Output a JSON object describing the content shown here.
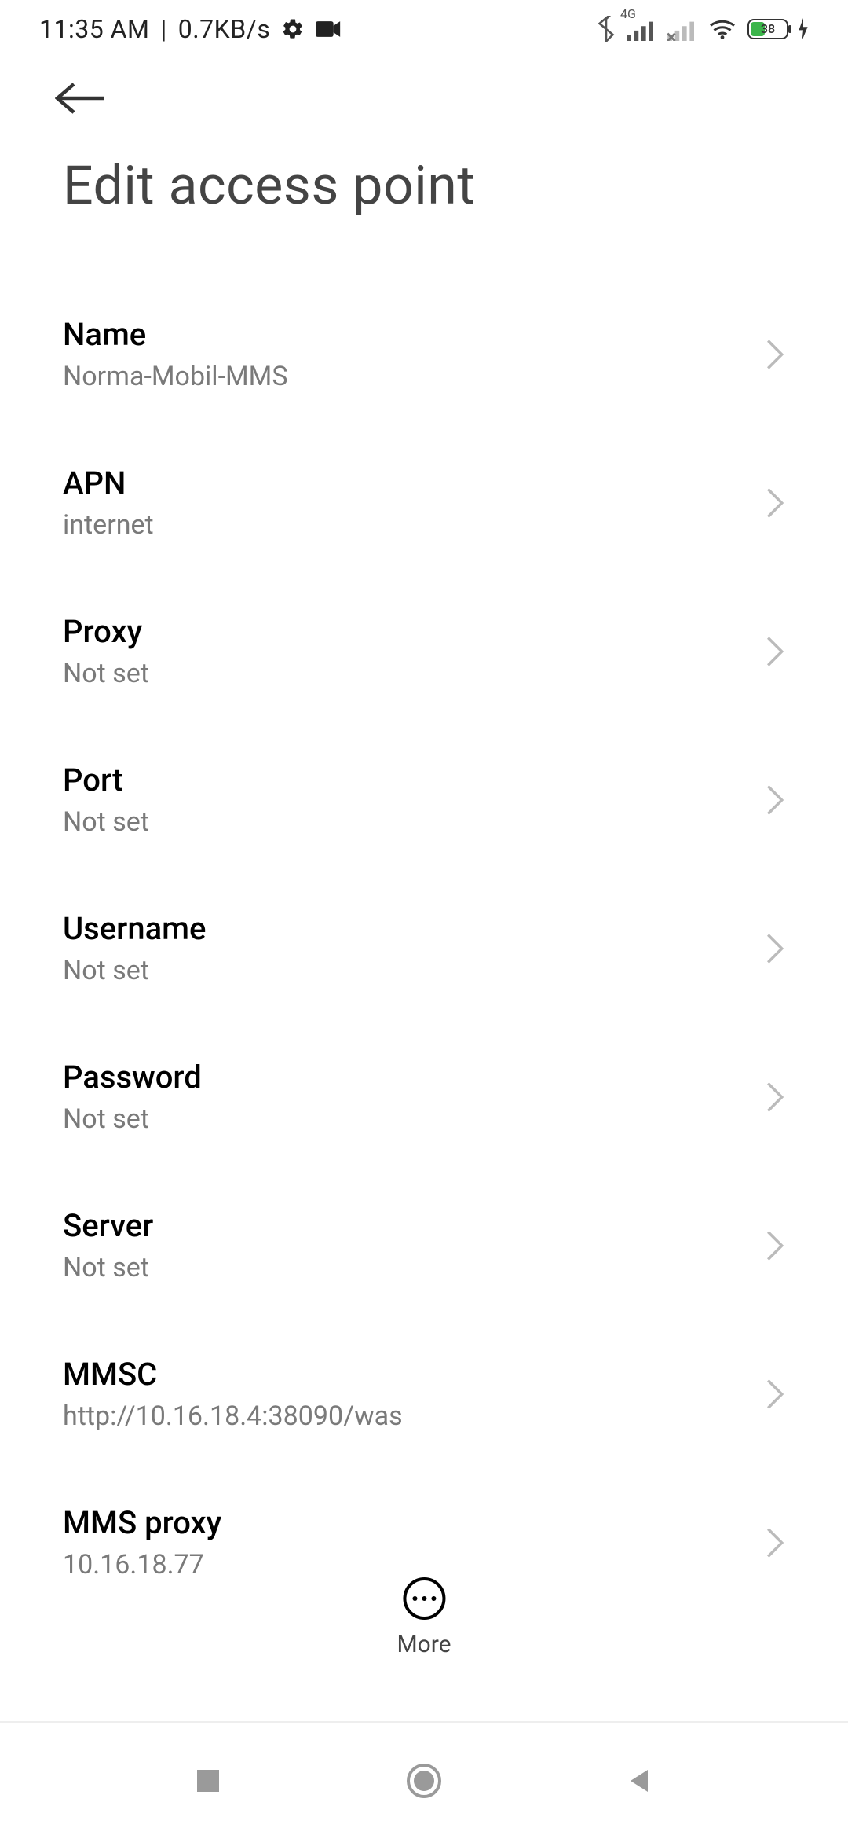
{
  "statusbar": {
    "time": "11:35 AM",
    "sep": "|",
    "speed": "0.7KB/s",
    "net_label": "4G",
    "battery_pct": "38"
  },
  "header": {
    "title": "Edit access point"
  },
  "rows": [
    {
      "label": "Name",
      "value": "Norma-Mobil-MMS"
    },
    {
      "label": "APN",
      "value": "internet"
    },
    {
      "label": "Proxy",
      "value": "Not set"
    },
    {
      "label": "Port",
      "value": "Not set"
    },
    {
      "label": "Username",
      "value": "Not set"
    },
    {
      "label": "Password",
      "value": "Not set"
    },
    {
      "label": "Server",
      "value": "Not set"
    },
    {
      "label": "MMSC",
      "value": "http://10.16.18.4:38090/was"
    },
    {
      "label": "MMS proxy",
      "value": "10.16.18.77"
    }
  ],
  "more": {
    "label": "More"
  }
}
